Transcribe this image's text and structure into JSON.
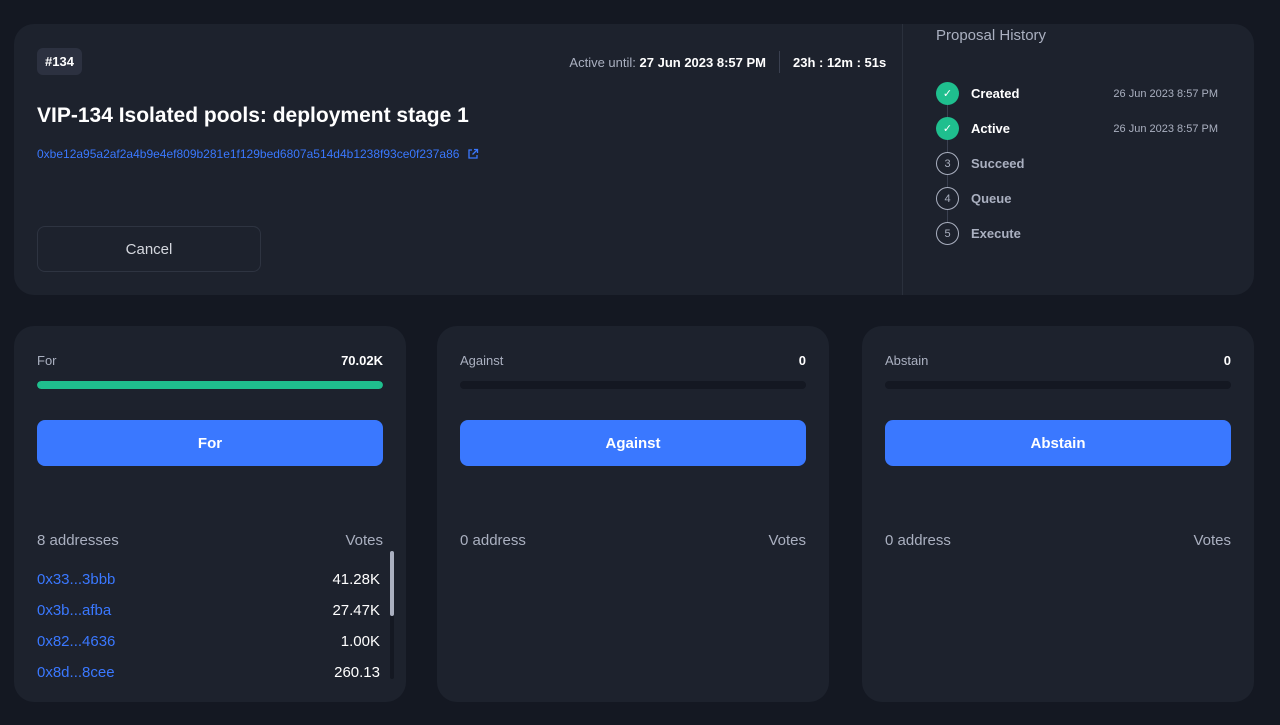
{
  "proposal": {
    "badge": "#134",
    "active_until_label": "Active until:",
    "active_until_value": "27 Jun 2023 8:57 PM",
    "countdown": "23h : 12m : 51s",
    "title": "VIP-134 Isolated pools: deployment stage 1",
    "address": "0xbe12a95a2af2a4b9e4ef809b281e1f129bed6807a514d4b1238f93ce0f237a86",
    "external_link_icon": "external-link-icon",
    "cancel_label": "Cancel"
  },
  "history": {
    "title": "Proposal History",
    "steps": [
      {
        "label": "Created",
        "date": "26 Jun 2023 8:57 PM",
        "state": "done",
        "marker": "✓"
      },
      {
        "label": "Active",
        "date": "26 Jun 2023 8:57 PM",
        "state": "done",
        "marker": "✓"
      },
      {
        "label": "Succeed",
        "date": "",
        "state": "todo",
        "marker": "3"
      },
      {
        "label": "Queue",
        "date": "",
        "state": "todo",
        "marker": "4"
      },
      {
        "label": "Execute",
        "date": "",
        "state": "todo",
        "marker": "5"
      }
    ]
  },
  "votes": {
    "for": {
      "label": "For",
      "total": "70.02K",
      "fill_fraction": 1.0,
      "button_label": "For",
      "addresses_label": "8 addresses",
      "votes_header": "Votes",
      "voters": [
        {
          "address": "0x33...3bbb",
          "votes": "41.28K"
        },
        {
          "address": "0x3b...afba",
          "votes": "27.47K"
        },
        {
          "address": "0x82...4636",
          "votes": "1.00K"
        },
        {
          "address": "0x8d...8cee",
          "votes": "260.13"
        }
      ]
    },
    "against": {
      "label": "Against",
      "total": "0",
      "fill_fraction": 0,
      "button_label": "Against",
      "addresses_label": "0 address",
      "votes_header": "Votes"
    },
    "abstain": {
      "label": "Abstain",
      "total": "0",
      "fill_fraction": 0,
      "button_label": "Abstain",
      "addresses_label": "0 address",
      "votes_header": "Votes"
    }
  },
  "colors": {
    "background": "#141822",
    "card": "#1d222d",
    "accent_blue": "#3a78ff",
    "success_green": "#1fbf8e",
    "muted_text": "#aab0c0"
  }
}
